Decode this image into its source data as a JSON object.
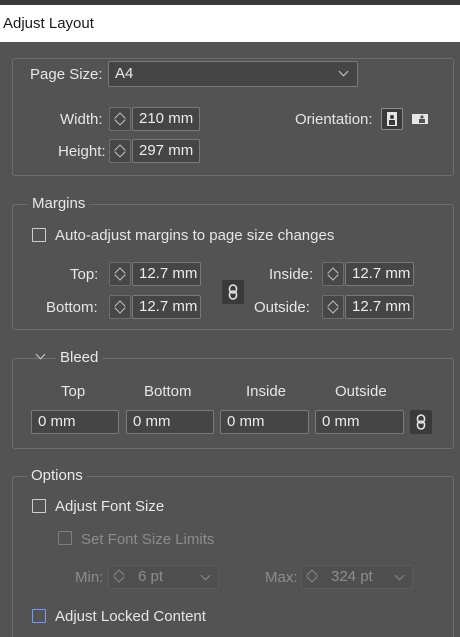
{
  "window": {
    "title": "Adjust Layout"
  },
  "page": {
    "page_size_label": "Page Size:",
    "page_size_value": "A4",
    "width_label": "Width:",
    "width_value": "210 mm",
    "height_label": "Height:",
    "height_value": "297 mm",
    "orientation_label": "Orientation:"
  },
  "margins": {
    "title": "Margins",
    "auto_adjust_label": "Auto-adjust margins to page size changes",
    "top_label": "Top:",
    "top_value": "12.7 mm",
    "bottom_label": "Bottom:",
    "bottom_value": "12.7 mm",
    "inside_label": "Inside:",
    "inside_value": "12.7 mm",
    "outside_label": "Outside:",
    "outside_value": "12.7 mm"
  },
  "bleed": {
    "title": "Bleed",
    "col_top": "Top",
    "col_bottom": "Bottom",
    "col_inside": "Inside",
    "col_outside": "Outside",
    "top_value": "0 mm",
    "bottom_value": "0 mm",
    "inside_value": "0 mm",
    "outside_value": "0 mm"
  },
  "options": {
    "title": "Options",
    "adjust_font_size_label": "Adjust Font Size",
    "set_font_size_limits_label": "Set Font Size Limits",
    "min_label": "Min:",
    "min_value": "6 pt",
    "max_label": "Max:",
    "max_value": "324 pt",
    "adjust_locked_content_label": "Adjust Locked Content"
  },
  "colors": {
    "panel_bg": "#535353",
    "field_bg": "#454545",
    "accent_checkbox": "#6fa0ff"
  }
}
